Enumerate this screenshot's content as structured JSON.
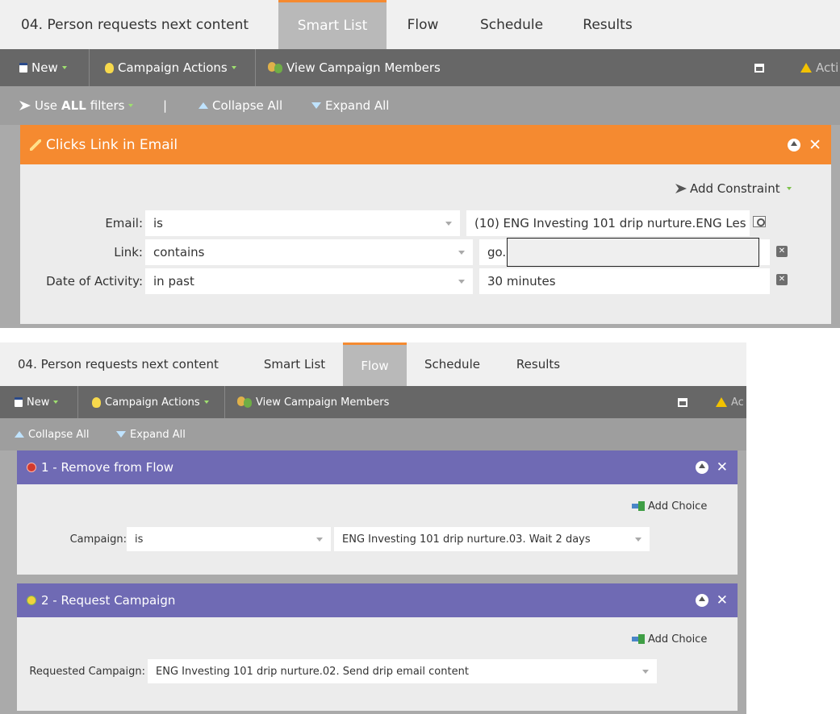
{
  "top": {
    "tabs": {
      "title": "04. Person requests next content",
      "smart_list": "Smart List",
      "flow": "Flow",
      "schedule": "Schedule",
      "results": "Results",
      "active": "Smart List"
    },
    "toolbar": {
      "new": "New",
      "campaign_actions": "Campaign Actions",
      "view_members": "View Campaign Members",
      "actions_cut": "Acti"
    },
    "filterbar": {
      "use": "Use",
      "all": "ALL",
      "filters": "filters",
      "divider": "|",
      "collapse_all": "Collapse All",
      "expand_all": "Expand All"
    },
    "filter_card": {
      "title": "Clicks Link in Email",
      "add_constraint": "Add Constraint",
      "rows": [
        {
          "label": "Email:",
          "operator": "is",
          "value": "(10) ENG Investing 101 drip nurture.ENG Les"
        },
        {
          "label": "Link:",
          "operator": "contains",
          "value": "go."
        },
        {
          "label": "Date of Activity:",
          "operator": "in past",
          "value": "30 minutes"
        }
      ]
    }
  },
  "bottom": {
    "tabs": {
      "title": "04. Person requests next content",
      "smart_list": "Smart List",
      "flow": "Flow",
      "schedule": "Schedule",
      "results": "Results",
      "active": "Flow"
    },
    "toolbar": {
      "new": "New",
      "campaign_actions": "Campaign Actions",
      "view_members": "View Campaign Members",
      "actions_cut": "Ac"
    },
    "filterbar": {
      "collapse_all": "Collapse All",
      "expand_all": "Expand All"
    },
    "steps": [
      {
        "title": "1 - Remove from Flow",
        "add_choice": "Add Choice",
        "label": "Campaign:",
        "operator": "is",
        "value": "ENG Investing 101 drip nurture.03. Wait 2 days"
      },
      {
        "title": "2 - Request Campaign",
        "add_choice": "Add Choice",
        "label": "Requested Campaign:",
        "value": "ENG Investing 101 drip nurture.02. Send drip email content"
      }
    ]
  },
  "colors": {
    "orange_header": "#f58a30",
    "purple_header": "#6f6ab4",
    "toolbar_dark": "#676767",
    "toolbar_light": "#9e9e9e",
    "active_tab": "#b9b9b9",
    "card_bg": "#ececec"
  }
}
